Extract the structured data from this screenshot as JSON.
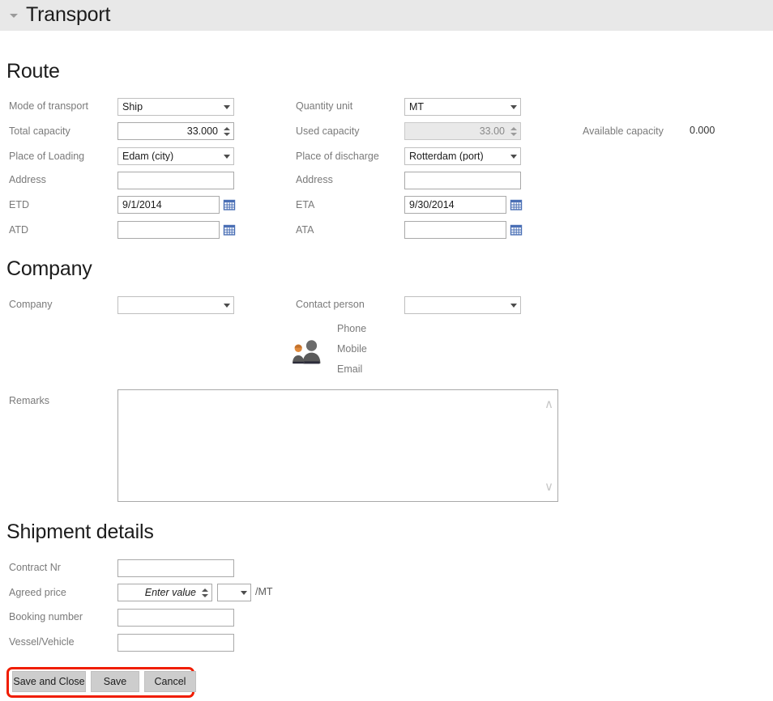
{
  "header": {
    "title": "Transport",
    "collapse_icon": "chevron-down-icon"
  },
  "sections": {
    "route": "Route",
    "company": "Company",
    "shipment": "Shipment details"
  },
  "route": {
    "mode_of_transport": {
      "label": "Mode of transport",
      "value": "Ship"
    },
    "total_capacity": {
      "label": "Total capacity",
      "value": "33.000"
    },
    "place_of_loading": {
      "label": "Place of Loading",
      "value": "Edam (city)"
    },
    "address_left": {
      "label": "Address",
      "value": ""
    },
    "etd": {
      "label": "ETD",
      "value": "9/1/2014"
    },
    "atd": {
      "label": "ATD",
      "value": ""
    },
    "quantity_unit": {
      "label": "Quantity unit",
      "value": "MT"
    },
    "used_capacity": {
      "label": "Used capacity",
      "value": "33.00"
    },
    "place_of_discharge": {
      "label": "Place of discharge",
      "value": "Rotterdam (port)"
    },
    "address_right": {
      "label": "Address",
      "value": ""
    },
    "eta": {
      "label": "ETA",
      "value": "9/30/2014"
    },
    "ata": {
      "label": "ATA",
      "value": ""
    },
    "available_capacity": {
      "label": "Available capacity",
      "value": "0.000"
    },
    "calendar_icon": "calendar-icon"
  },
  "company": {
    "company": {
      "label": "Company",
      "value": ""
    },
    "contact_person": {
      "label": "Contact person",
      "value": ""
    },
    "phone_label": "Phone",
    "mobile_label": "Mobile",
    "email_label": "Email",
    "contacts_icon": "contacts-icon",
    "remarks": {
      "label": "Remarks",
      "value": ""
    }
  },
  "shipment": {
    "contract_nr": {
      "label": "Contract Nr",
      "value": ""
    },
    "agreed_price": {
      "label": "Agreed price",
      "placeholder": "Enter value",
      "value": "",
      "unit_suffix": "/MT",
      "currency": ""
    },
    "booking_number": {
      "label": "Booking number",
      "value": ""
    },
    "vessel_vehicle": {
      "label": "Vessel/Vehicle",
      "value": ""
    }
  },
  "footer": {
    "save_and_close": "Save and Close",
    "save": "Save",
    "cancel": "Cancel",
    "highlight_color": "#f01d00"
  }
}
